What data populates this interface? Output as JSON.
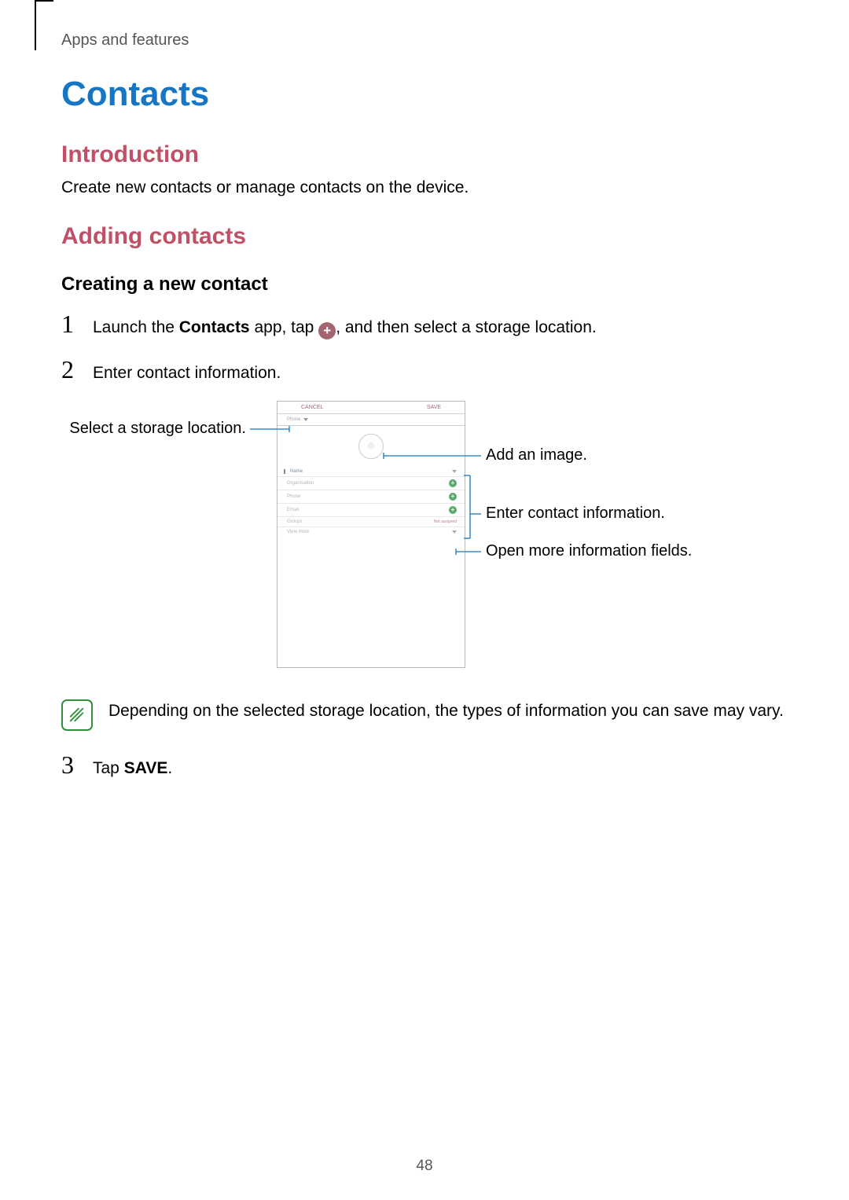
{
  "breadcrumb": "Apps and features",
  "title": "Contacts",
  "intro_heading": "Introduction",
  "intro_text": "Create new contacts or manage contacts on the device.",
  "adding_heading": "Adding contacts",
  "creating_heading": "Creating a new contact",
  "steps": {
    "s1": {
      "num": "1",
      "pre": "Launch the ",
      "bold": "Contacts",
      "mid": " app, tap ",
      "post": ", and then select a storage location."
    },
    "s2": {
      "num": "2",
      "text": "Enter contact information."
    },
    "s3": {
      "num": "3",
      "pre": "Tap ",
      "bold": "SAVE",
      "post": "."
    }
  },
  "callouts": {
    "storage": "Select a storage location.",
    "add_image": "Add an image.",
    "enter_info": "Enter contact information.",
    "more_fields": "Open more information fields."
  },
  "phone": {
    "cancel": "CANCEL",
    "save": "SAVE",
    "saveto": "Phone",
    "name": "Name",
    "org": "Organisation",
    "phone": "Phone",
    "email": "Email",
    "groups": "Groups",
    "groups_right": "Not assigned",
    "viewmore": "View more"
  },
  "note": "Depending on the selected storage location, the types of information you can save may vary.",
  "page_number": "48"
}
